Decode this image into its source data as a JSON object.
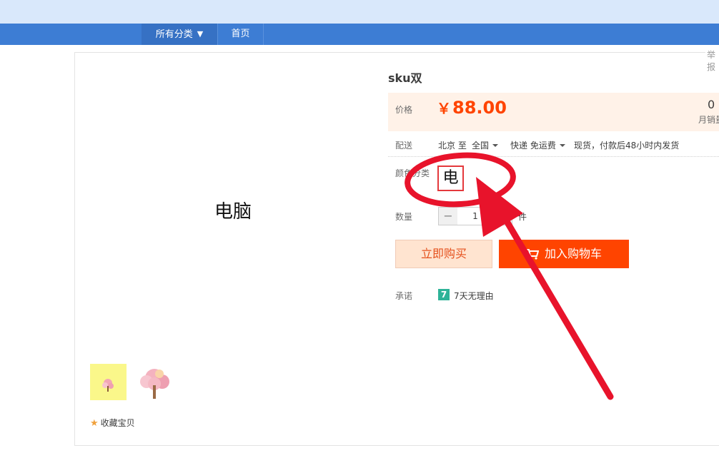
{
  "nav": {
    "categories_label": "所有分类",
    "home_label": "首页"
  },
  "report_label": "举报",
  "product": {
    "main_image_text": "电脑",
    "favorite_label": "收藏宝贝",
    "title": "sku双",
    "price_label": "价格",
    "currency_symbol": "￥",
    "price": "88.00",
    "monthly_sales": "0",
    "monthly_sales_label": "月销量",
    "shipping": {
      "label": "配送",
      "from": "北京 至",
      "to": "全国",
      "method": "快递 免运费",
      "note": "现货，付款后48小时内发货"
    },
    "color_label": "颜色分类",
    "color_option": "电脑",
    "quantity_label": "数量",
    "quantity_value": "1",
    "quantity_minus": "−",
    "quantity_plus": "+",
    "quantity_unit": "件",
    "buy_now_label": "立即购买",
    "add_to_cart_label": "加入购物车",
    "promise_label": "承诺",
    "promise_icon_text": "7",
    "promise_text": "7天无理由"
  },
  "colors": {
    "nav_bg": "#3d7dd4",
    "price": "#ff4400",
    "annotation": "#e8132b"
  },
  "icons": [
    "dropdown-triangle-icon",
    "star-icon",
    "cart-icon",
    "seven-day-icon",
    "caret-down-icon"
  ]
}
